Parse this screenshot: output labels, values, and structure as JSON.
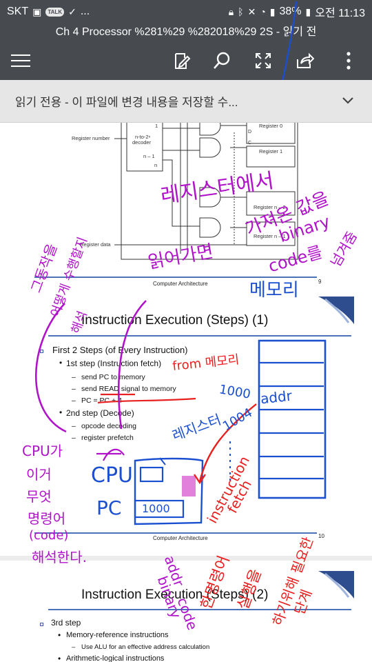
{
  "status_bar": {
    "carrier": "SKT",
    "talk_badge": "TALK",
    "more": "...",
    "battery": "38%",
    "time": "오전 11:13"
  },
  "title_bar": {
    "title": "Ch 4 Processor %281%29 %282018%29 2S - 읽기 전"
  },
  "toolbar": {
    "icons": [
      "menu-icon",
      "edit-icon",
      "search-icon",
      "fullscreen-icon",
      "share-icon",
      "more-vert-icon"
    ]
  },
  "readonly_bar": {
    "message": "읽기 전용 - 이 파일에 변경 내용을 저장할 수..."
  },
  "slides": [
    {
      "diagram_labels": {
        "register_number": "Register number",
        "decoder": "n-to-2ⁿ decoder",
        "decoder_line1": "n-to-2ⁿ",
        "decoder_line2": "decoder",
        "port_1": "1",
        "port_n1": "n – 1",
        "port_n": "n",
        "register_0": "Register 0",
        "register_1": "Register 1",
        "register_n2": "Register n – 2",
        "register_n1": "Register n – 1",
        "register_data": "Register data",
        "c": "C",
        "d": "D"
      },
      "footer": "Computer Architecture",
      "page": "9"
    },
    {
      "title": "Instruction Execution (Steps) (1)",
      "bullets": [
        {
          "level": 1,
          "text": "First 2 Steps (of Every Instruction)"
        },
        {
          "level": 2,
          "text": "1st step (Instruction fetch)"
        },
        {
          "level": 3,
          "text": "send PC to memory"
        },
        {
          "level": 3,
          "text": "send READ signal to memory"
        },
        {
          "level": 3,
          "text": "PC = PC + 4"
        },
        {
          "level": 2,
          "text": "2nd step (Decode)"
        },
        {
          "level": 3,
          "text": "opcode decoding"
        },
        {
          "level": 3,
          "text": "register prefetch"
        }
      ],
      "footer": "Computer Architecture",
      "page": "10"
    },
    {
      "title": "Instruction Execution (Steps) (2)",
      "bullets": [
        {
          "level": 1,
          "text": "3rd step"
        },
        {
          "level": 2,
          "text": "Memory-reference instructions"
        },
        {
          "level": 3,
          "text": "Use ALU for an effective address calculation"
        },
        {
          "level": 2,
          "text": "Arithmetic-logical instructions"
        }
      ]
    }
  ],
  "handwriting": {
    "purple_register": "레지스터에서",
    "purple_value": "가져온 값을",
    "purple_read": "읽어가면",
    "purple_binary": "binary",
    "purple_code": "code를",
    "purple_pass": "넘겨줌",
    "purple_cpu_left1": "그동작을",
    "purple_cpu_left2": "어떻게 수행할지",
    "purple_cpu_left3": "해석",
    "purple_cpu": "CPU가",
    "purple_cpu2": "이거",
    "purple_cpu3": "무엇",
    "purple_cpu4": "명령어",
    "purple_cpu5": "(code)",
    "purple_cpu6": "해석한다.",
    "blue_memory": "메모리",
    "blue_addr": "addr",
    "blue_1000": "1000",
    "blue_1004": "1004",
    "blue_register": "레지스터",
    "blue_cpu": "CPU",
    "blue_pc": "PC",
    "blue_pc_val": "1000",
    "red_from": "from 메모리",
    "red_fetch1": "instruction",
    "red_fetch2": "fetch",
    "red_exec1": "한명령어",
    "red_exec2": "실행을",
    "red_exec3": "하기위해 필요한",
    "red_exec4": "단계",
    "purple_addr": "addr",
    "purple_binary2": "binary",
    "purple_code2": "code"
  },
  "colors": {
    "chrome": "#474a4f",
    "readonly_bg": "#e6e6e6",
    "ink_purple": "#b012c9",
    "ink_blue": "#1a4fd0",
    "ink_red": "#e8201f",
    "slide_accent": "#4a72b8"
  }
}
